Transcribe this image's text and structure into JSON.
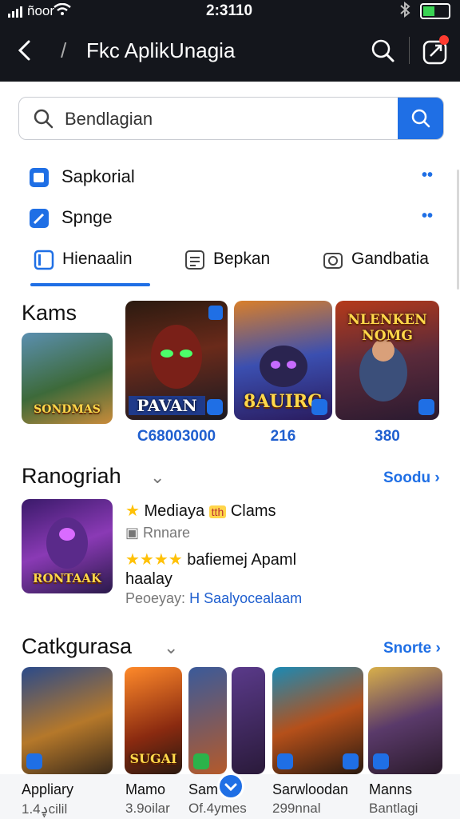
{
  "status": {
    "carrier": "ñoor",
    "time": "2:3110"
  },
  "appbar": {
    "title": "Fkc AplikUnagia"
  },
  "search": {
    "value": "Bendlagian"
  },
  "rows": [
    {
      "label": "Sapkorial"
    },
    {
      "label": "Spnge"
    }
  ],
  "tabs": [
    {
      "label": "Hienaalin"
    },
    {
      "label": "Bepkan"
    },
    {
      "label": "Gandbatia"
    }
  ],
  "games": {
    "title": "Kams",
    "tiles": [
      {
        "caption": "SONDMAS"
      },
      {
        "caption": "PAVAN",
        "count": "C68003000"
      },
      {
        "caption": "8AUIRG",
        "count": "216"
      },
      {
        "caption": "NLENKEN NOMG",
        "count": "380"
      }
    ]
  },
  "featured": {
    "title": "Ranogriah",
    "see_all": "Soodu",
    "line1": "Mediaya",
    "line1b": "Clams",
    "line2": "Rnnare",
    "line3": "bafiemej Apaml",
    "line4": "haalay",
    "line5_label": "Peoeyay:",
    "line5_value": "H Saalyocealaam",
    "cover_caption": "RONTAAK"
  },
  "categories": {
    "title": "Catkgurasa",
    "see_all": "Snorte",
    "items": [
      {
        "name": "Appliary",
        "sub": "ࢮ1.4cilil"
      },
      {
        "name": "Mamo",
        "sub": "3.9oilar"
      },
      {
        "name": "Sam",
        "sub": "Of.4ymes"
      },
      {
        "name": "Sarwloodan",
        "sub": "299nnal"
      },
      {
        "name": "Manns",
        "sub": "Bantlagi"
      }
    ],
    "tile_caption": "SUGAI"
  },
  "colors": {
    "accent": "#1f6fe5",
    "header": "#14161c"
  }
}
